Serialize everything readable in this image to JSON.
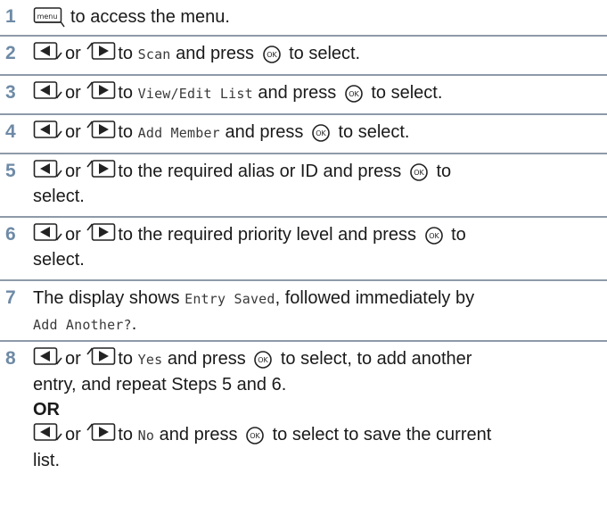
{
  "steps": [
    {
      "num": "1",
      "menu_key": "menu",
      "text_after_menu": "to access the menu."
    },
    {
      "num": "2",
      "or_word": "or",
      "to_word": "to",
      "display": "Scan",
      "and_press": "and press",
      "to_select": "to select."
    },
    {
      "num": "3",
      "or_word": "or",
      "to_word": "to",
      "display": "View/Edit List",
      "and_press": "and press",
      "to_select": "to select."
    },
    {
      "num": "4",
      "or_word": "or",
      "to_word": "to",
      "display": "Add Member",
      "and_press": "and press",
      "to_select": "to select."
    },
    {
      "num": "5",
      "or_word": "or",
      "text_a": "to the required alias or ID and press",
      "text_b": "to",
      "text_c": "select."
    },
    {
      "num": "6",
      "or_word": "or",
      "text_a": "to the required priority level and press",
      "text_b": "to",
      "text_c": "select."
    },
    {
      "num": "7",
      "text_a": "The display shows",
      "display_a": "Entry Saved",
      "text_b": ", followed immediately by",
      "display_b": "Add Another?",
      "text_c": "."
    },
    {
      "num": "8",
      "or_word": "or",
      "to_word": "to",
      "display_yes": "Yes",
      "and_press": "and press",
      "text_yes_after": "to select, to add another",
      "text_yes_cont": "entry, and repeat Steps 5 and 6.",
      "or_separator": "OR",
      "display_no": "No",
      "text_no_after": "to select to save the current",
      "text_no_cont": "list."
    }
  ]
}
